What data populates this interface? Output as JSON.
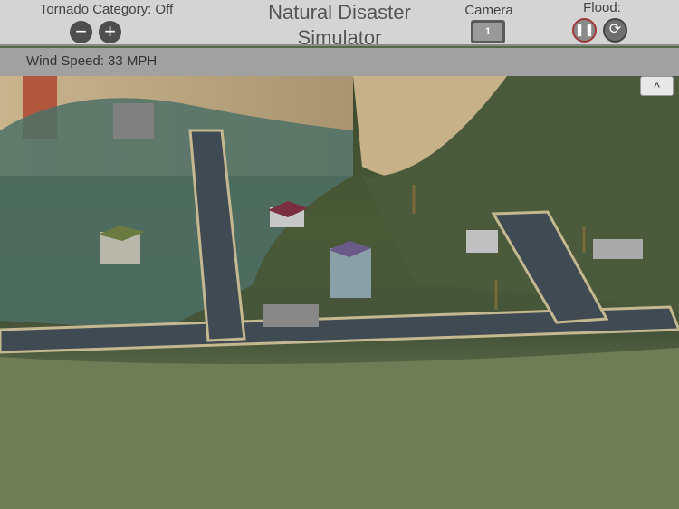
{
  "header": {
    "tornado_label": "Tornado Category: Off",
    "title_line1": "Natural Disaster",
    "title_line2": "Simulator",
    "camera_label": "Camera",
    "camera_number": "1",
    "flood_label": "Flood:"
  },
  "status": {
    "wind_speed": "Wind Speed: 33 MPH"
  },
  "icons": {
    "minus": "−",
    "plus": "+",
    "pause": "❚❚",
    "reset": "⟳",
    "collapse": "^"
  }
}
